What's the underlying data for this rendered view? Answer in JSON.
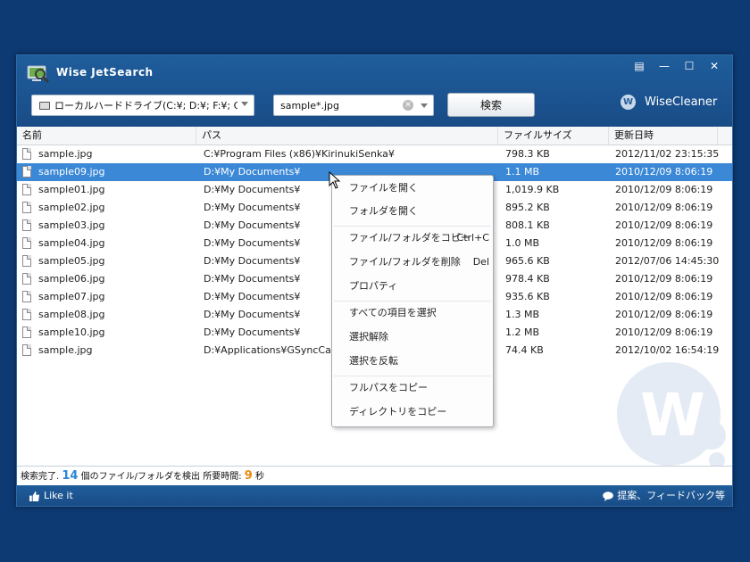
{
  "app": {
    "title": "Wise JetSearch"
  },
  "window_buttons": [
    "▤",
    "—",
    "☐",
    "✕"
  ],
  "toolbar": {
    "drive_value": "ローカルハードドライブ(C:¥; D:¥; F:¥; G:¥; ...",
    "search_value": "sample*.jpg",
    "search_button": "検索",
    "brand": "WiseCleaner"
  },
  "columns": [
    "名前",
    "パス",
    "ファイルサイズ",
    "更新日時"
  ],
  "rows": [
    {
      "name": "sample.jpg",
      "path": "C:¥Program Files (x86)¥KirinukiSenka¥",
      "size": "798.3 KB",
      "date": "2012/11/02 23:15:35"
    },
    {
      "name": "sample09.jpg",
      "path": "D:¥My Documents¥",
      "size": "1.1 MB",
      "date": "2010/12/09 8:06:19"
    },
    {
      "name": "sample01.jpg",
      "path": "D:¥My Documents¥",
      "size": "1,019.9 KB",
      "date": "2010/12/09 8:06:19"
    },
    {
      "name": "sample02.jpg",
      "path": "D:¥My Documents¥",
      "size": "895.2 KB",
      "date": "2010/12/09 8:06:19"
    },
    {
      "name": "sample03.jpg",
      "path": "D:¥My Documents¥",
      "size": "808.1 KB",
      "date": "2010/12/09 8:06:19"
    },
    {
      "name": "sample04.jpg",
      "path": "D:¥My Documents¥",
      "size": "1.0 MB",
      "date": "2010/12/09 8:06:19"
    },
    {
      "name": "sample05.jpg",
      "path": "D:¥My Documents¥",
      "size": "965.6 KB",
      "date": "2012/07/06 14:45:30"
    },
    {
      "name": "sample06.jpg",
      "path": "D:¥My Documents¥",
      "size": "978.4 KB",
      "date": "2010/12/09 8:06:19"
    },
    {
      "name": "sample07.jpg",
      "path": "D:¥My Documents¥",
      "size": "935.6 KB",
      "date": "2010/12/09 8:06:19"
    },
    {
      "name": "sample08.jpg",
      "path": "D:¥My Documents¥",
      "size": "1.3 MB",
      "date": "2010/12/09 8:06:19"
    },
    {
      "name": "sample10.jpg",
      "path": "D:¥My Documents¥",
      "size": "1.2 MB",
      "date": "2010/12/09 8:06:19"
    },
    {
      "name": "sample.jpg",
      "path": "D:¥Applications¥GSyncCaler",
      "size": "74.4 KB",
      "date": "2012/10/02 16:54:19"
    }
  ],
  "context_menu": [
    {
      "label": "ファイルを開く",
      "shortcut": ""
    },
    {
      "label": "フォルダを開く",
      "shortcut": ""
    },
    {
      "label": "ファイル/フォルダをコピー",
      "shortcut": "Ctrl+C"
    },
    {
      "label": "ファイル/フォルダを削除",
      "shortcut": "Del"
    },
    {
      "label": "プロパティ",
      "shortcut": ""
    },
    {
      "label": "すべての項目を選択",
      "shortcut": ""
    },
    {
      "label": "選択解除",
      "shortcut": ""
    },
    {
      "label": "選択を反転",
      "shortcut": ""
    },
    {
      "label": "フルパスをコピー",
      "shortcut": ""
    },
    {
      "label": "ディレクトリをコピー",
      "shortcut": ""
    }
  ],
  "status": {
    "prefix": "検索完了.",
    "count": "14",
    "middle": "個のファイル/フォルダを検出 所要時間:",
    "seconds": "9",
    "suffix": "秒"
  },
  "footer": {
    "like": "Like it",
    "feedback": "提案、フィードバック等"
  }
}
